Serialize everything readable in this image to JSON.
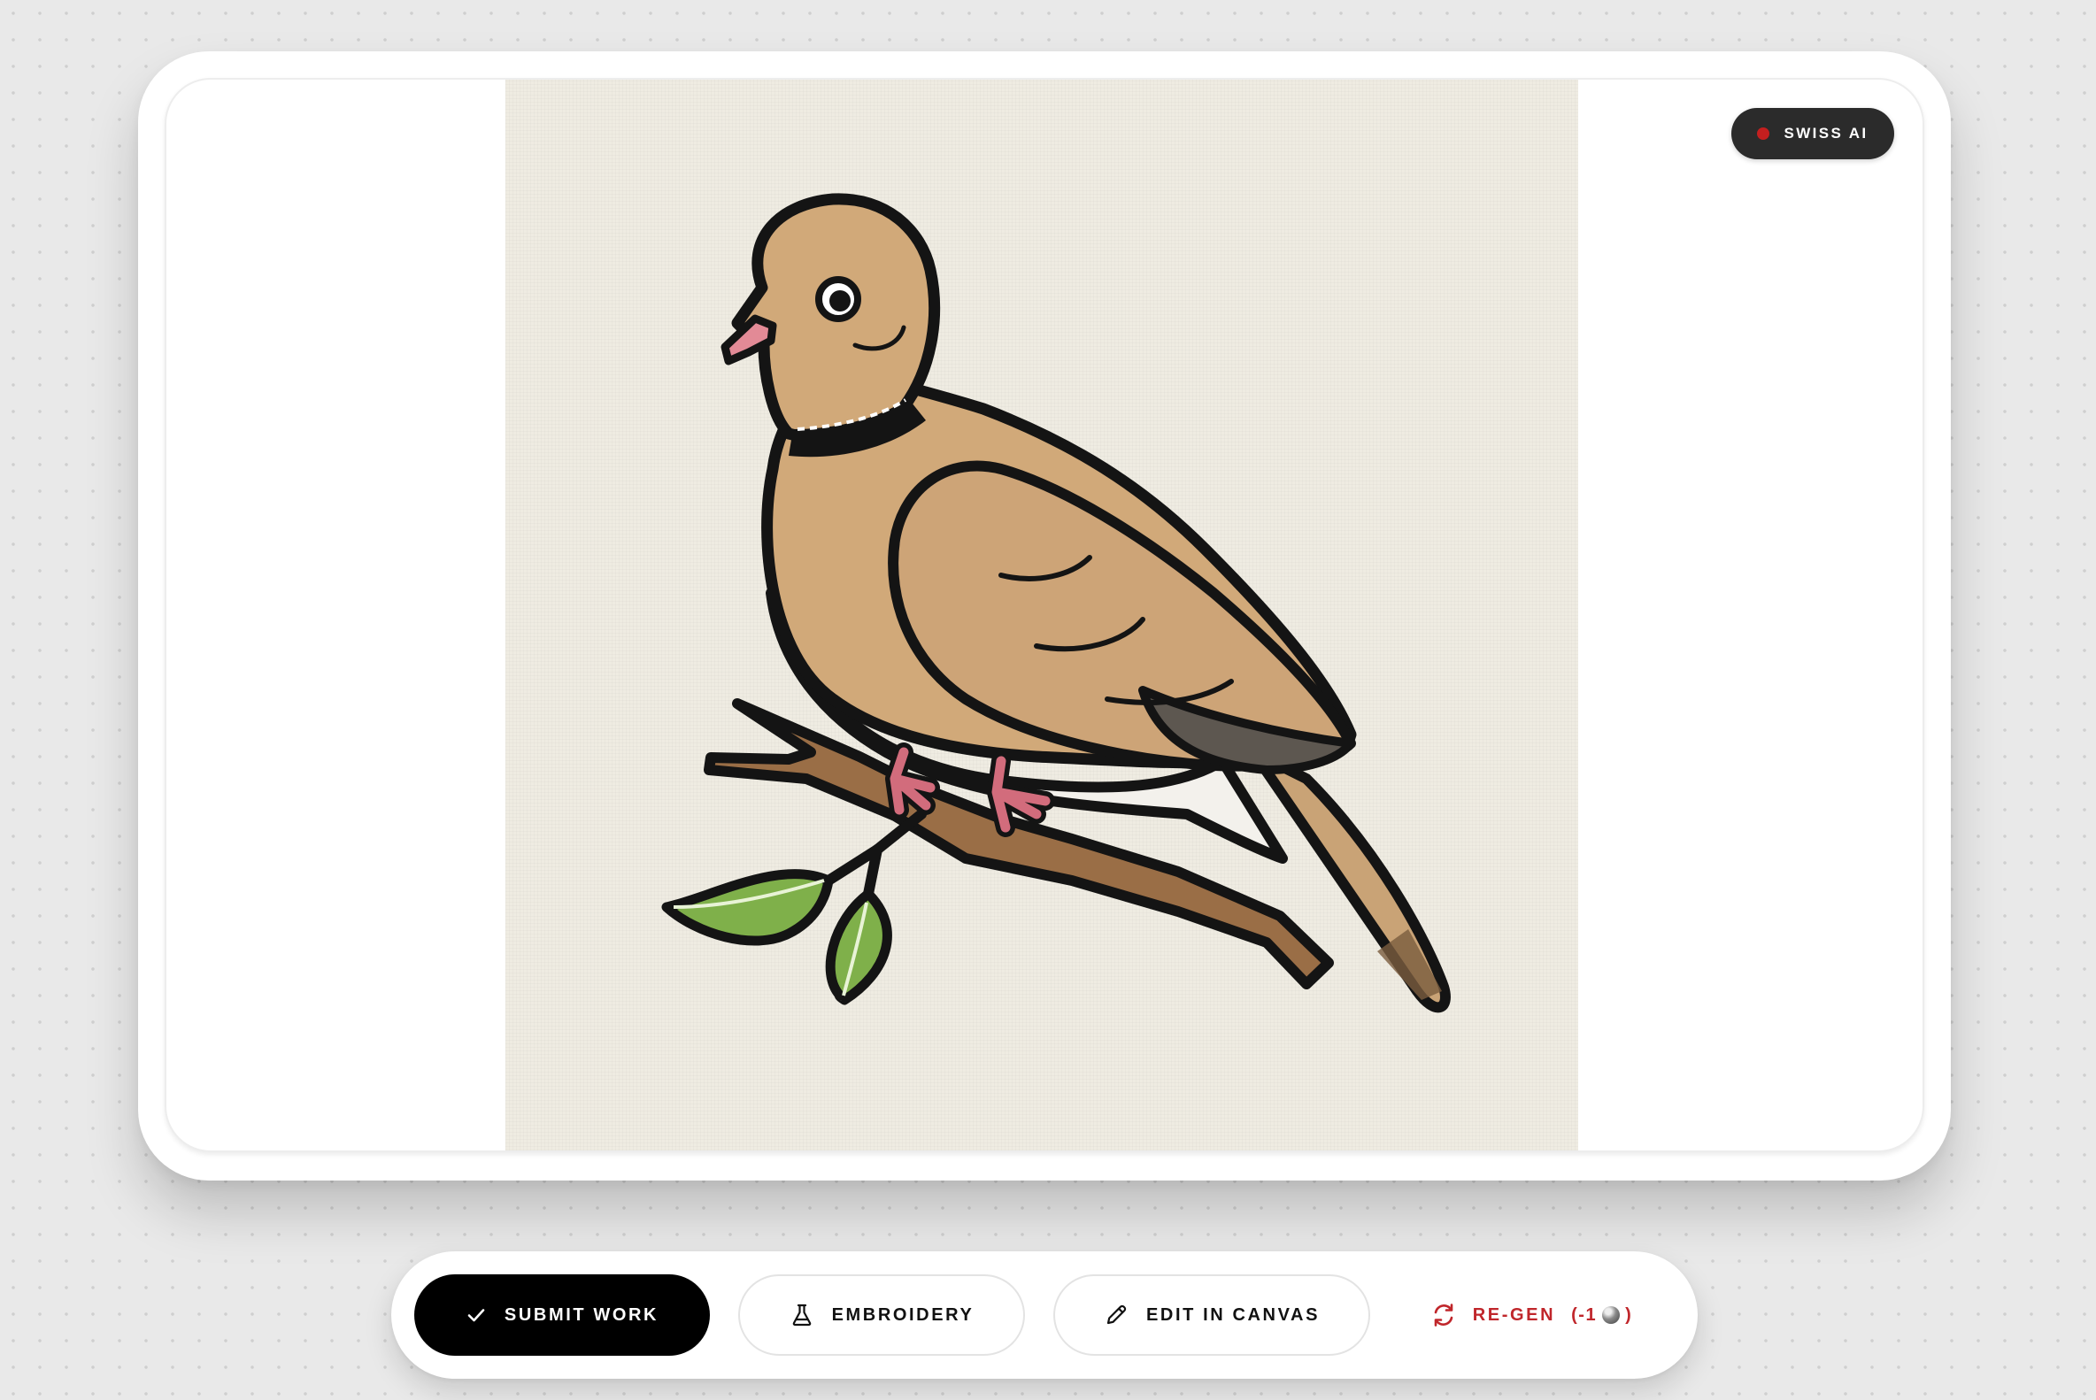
{
  "badge": {
    "label": "SWISS AI",
    "dot_color": "#c41f1f"
  },
  "artwork": {
    "icon": "dove-on-branch-illustration"
  },
  "toolbar": {
    "submit_label": "SUBMIT WORK",
    "submit_icon": "checkmark-icon",
    "embroidery_label": "EMBROIDERY",
    "embroidery_icon": "flask-icon",
    "edit_canvas_label": "EDIT IN CANVAS",
    "edit_canvas_icon": "pencil-icon",
    "regen_label": "RE-GEN",
    "regen_cost_prefix": "(-1",
    "regen_cost_suffix": ")",
    "regen_icon": "refresh-icon",
    "coin_icon": "coin-icon"
  },
  "colors": {
    "accent_red": "#c0262b",
    "primary_button": "#000000",
    "badge_bg": "#2b2b2b"
  }
}
